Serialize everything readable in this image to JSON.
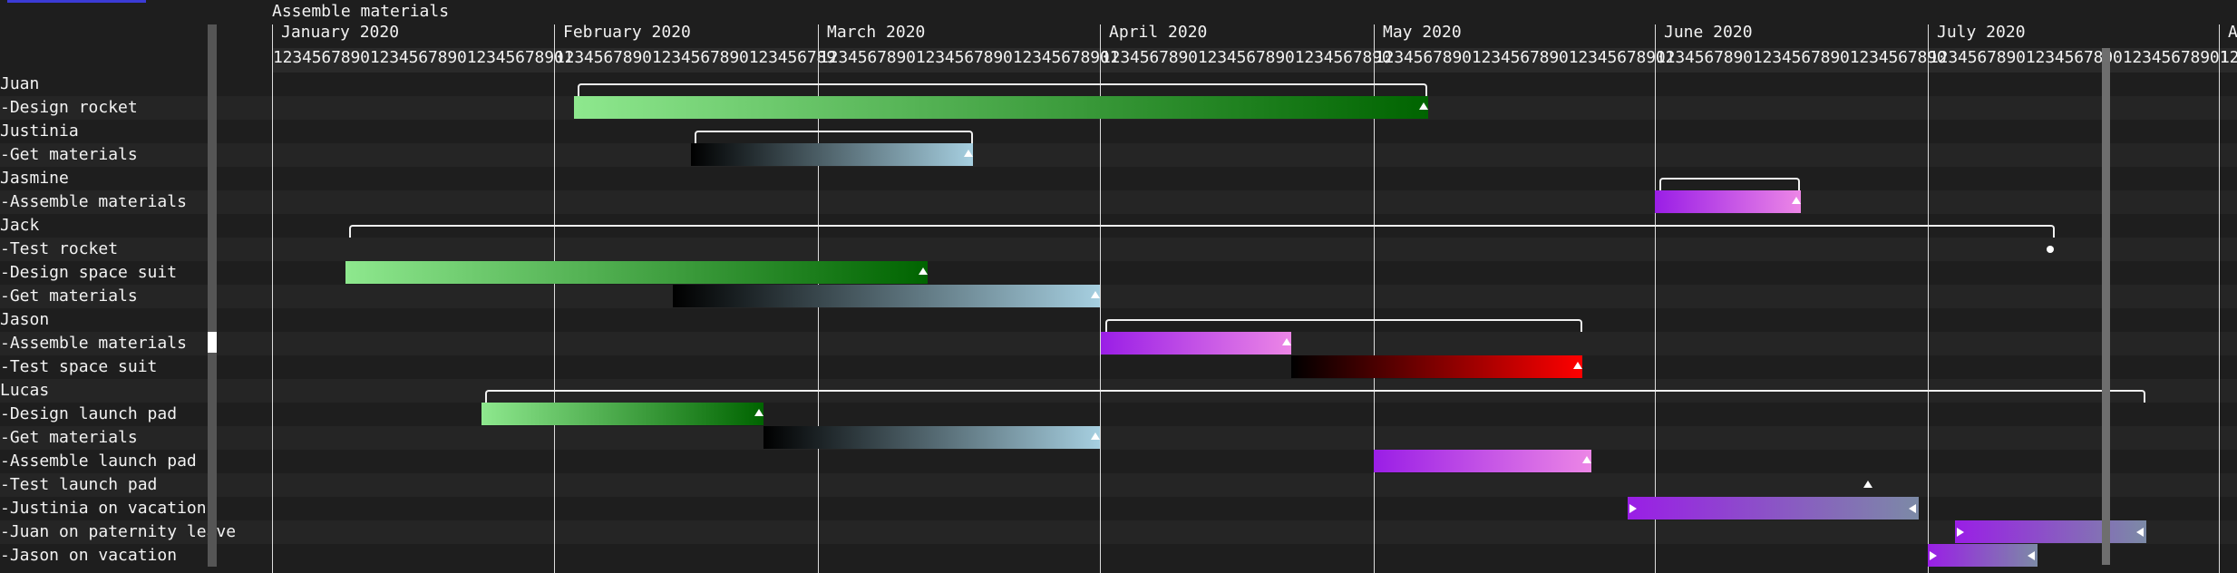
{
  "title": "Assemble materials",
  "months": [
    "January 2020",
    "February 2020",
    "March 2020",
    "April 2020",
    "May 2020",
    "June 2020",
    "July 2020",
    "Au"
  ],
  "day_strings": [
    "1234567890123456789012345678901",
    "12345678901234567890123456789",
    "1234567890123456789012345678901",
    "123456789012345678901234567890",
    "1234567890123456789012345678901",
    "123456789012345678901234567890",
    "1234567890123456789012345678901",
    "12"
  ],
  "rows": [
    "Juan",
    "-Design rocket",
    "Justinia",
    "-Get materials",
    "Jasmine",
    "-Assemble materials",
    "Jack",
    "-Test rocket",
    "-Design space suit",
    "-Get materials",
    "Jason",
    "-Assemble materials",
    "-Test space suit",
    "Lucas",
    "-Design launch pad",
    "-Get materials",
    "-Assemble launch pad",
    "-Test launch pad",
    "-Justinia on vacation",
    "-Juan on paternity leave",
    "-Jason on vacation"
  ],
  "colors": {
    "design_start": "#8ee88e",
    "design_end": "#006400",
    "materials_start": "#000000",
    "materials_end": "#a6cfe0",
    "assemble_start": "#9a1ee6",
    "assemble_end": "#ec86e6",
    "test_start": "#000000",
    "test_end": "#ff0000",
    "leave_start": "#9a1ee6",
    "leave_end": "#7c8aa6"
  },
  "bar_icons": [
    "tri-up",
    "tri-right",
    "tri-left",
    "dot"
  ]
}
